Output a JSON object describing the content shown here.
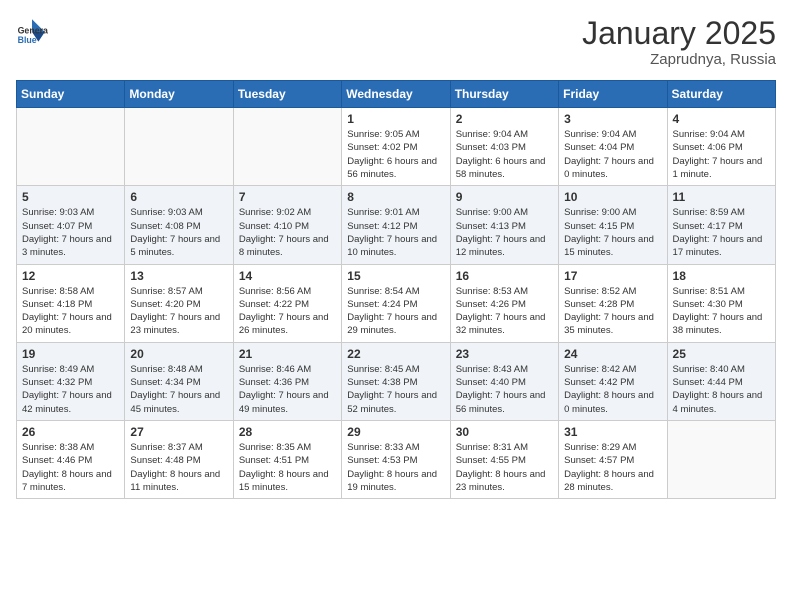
{
  "header": {
    "logo": {
      "general": "General",
      "blue": "Blue"
    },
    "title": "January 2025",
    "location": "Zaprudnya, Russia"
  },
  "days_of_week": [
    "Sunday",
    "Monday",
    "Tuesday",
    "Wednesday",
    "Thursday",
    "Friday",
    "Saturday"
  ],
  "weeks": [
    [
      {
        "day": "",
        "info": ""
      },
      {
        "day": "",
        "info": ""
      },
      {
        "day": "",
        "info": ""
      },
      {
        "day": "1",
        "info": "Sunrise: 9:05 AM\nSunset: 4:02 PM\nDaylight: 6 hours\nand 56 minutes."
      },
      {
        "day": "2",
        "info": "Sunrise: 9:04 AM\nSunset: 4:03 PM\nDaylight: 6 hours\nand 58 minutes."
      },
      {
        "day": "3",
        "info": "Sunrise: 9:04 AM\nSunset: 4:04 PM\nDaylight: 7 hours\nand 0 minutes."
      },
      {
        "day": "4",
        "info": "Sunrise: 9:04 AM\nSunset: 4:06 PM\nDaylight: 7 hours\nand 1 minute."
      }
    ],
    [
      {
        "day": "5",
        "info": "Sunrise: 9:03 AM\nSunset: 4:07 PM\nDaylight: 7 hours\nand 3 minutes."
      },
      {
        "day": "6",
        "info": "Sunrise: 9:03 AM\nSunset: 4:08 PM\nDaylight: 7 hours\nand 5 minutes."
      },
      {
        "day": "7",
        "info": "Sunrise: 9:02 AM\nSunset: 4:10 PM\nDaylight: 7 hours\nand 8 minutes."
      },
      {
        "day": "8",
        "info": "Sunrise: 9:01 AM\nSunset: 4:12 PM\nDaylight: 7 hours\nand 10 minutes."
      },
      {
        "day": "9",
        "info": "Sunrise: 9:00 AM\nSunset: 4:13 PM\nDaylight: 7 hours\nand 12 minutes."
      },
      {
        "day": "10",
        "info": "Sunrise: 9:00 AM\nSunset: 4:15 PM\nDaylight: 7 hours\nand 15 minutes."
      },
      {
        "day": "11",
        "info": "Sunrise: 8:59 AM\nSunset: 4:17 PM\nDaylight: 7 hours\nand 17 minutes."
      }
    ],
    [
      {
        "day": "12",
        "info": "Sunrise: 8:58 AM\nSunset: 4:18 PM\nDaylight: 7 hours\nand 20 minutes."
      },
      {
        "day": "13",
        "info": "Sunrise: 8:57 AM\nSunset: 4:20 PM\nDaylight: 7 hours\nand 23 minutes."
      },
      {
        "day": "14",
        "info": "Sunrise: 8:56 AM\nSunset: 4:22 PM\nDaylight: 7 hours\nand 26 minutes."
      },
      {
        "day": "15",
        "info": "Sunrise: 8:54 AM\nSunset: 4:24 PM\nDaylight: 7 hours\nand 29 minutes."
      },
      {
        "day": "16",
        "info": "Sunrise: 8:53 AM\nSunset: 4:26 PM\nDaylight: 7 hours\nand 32 minutes."
      },
      {
        "day": "17",
        "info": "Sunrise: 8:52 AM\nSunset: 4:28 PM\nDaylight: 7 hours\nand 35 minutes."
      },
      {
        "day": "18",
        "info": "Sunrise: 8:51 AM\nSunset: 4:30 PM\nDaylight: 7 hours\nand 38 minutes."
      }
    ],
    [
      {
        "day": "19",
        "info": "Sunrise: 8:49 AM\nSunset: 4:32 PM\nDaylight: 7 hours\nand 42 minutes."
      },
      {
        "day": "20",
        "info": "Sunrise: 8:48 AM\nSunset: 4:34 PM\nDaylight: 7 hours\nand 45 minutes."
      },
      {
        "day": "21",
        "info": "Sunrise: 8:46 AM\nSunset: 4:36 PM\nDaylight: 7 hours\nand 49 minutes."
      },
      {
        "day": "22",
        "info": "Sunrise: 8:45 AM\nSunset: 4:38 PM\nDaylight: 7 hours\nand 52 minutes."
      },
      {
        "day": "23",
        "info": "Sunrise: 8:43 AM\nSunset: 4:40 PM\nDaylight: 7 hours\nand 56 minutes."
      },
      {
        "day": "24",
        "info": "Sunrise: 8:42 AM\nSunset: 4:42 PM\nDaylight: 8 hours\nand 0 minutes."
      },
      {
        "day": "25",
        "info": "Sunrise: 8:40 AM\nSunset: 4:44 PM\nDaylight: 8 hours\nand 4 minutes."
      }
    ],
    [
      {
        "day": "26",
        "info": "Sunrise: 8:38 AM\nSunset: 4:46 PM\nDaylight: 8 hours\nand 7 minutes."
      },
      {
        "day": "27",
        "info": "Sunrise: 8:37 AM\nSunset: 4:48 PM\nDaylight: 8 hours\nand 11 minutes."
      },
      {
        "day": "28",
        "info": "Sunrise: 8:35 AM\nSunset: 4:51 PM\nDaylight: 8 hours\nand 15 minutes."
      },
      {
        "day": "29",
        "info": "Sunrise: 8:33 AM\nSunset: 4:53 PM\nDaylight: 8 hours\nand 19 minutes."
      },
      {
        "day": "30",
        "info": "Sunrise: 8:31 AM\nSunset: 4:55 PM\nDaylight: 8 hours\nand 23 minutes."
      },
      {
        "day": "31",
        "info": "Sunrise: 8:29 AM\nSunset: 4:57 PM\nDaylight: 8 hours\nand 28 minutes."
      },
      {
        "day": "",
        "info": ""
      }
    ]
  ]
}
